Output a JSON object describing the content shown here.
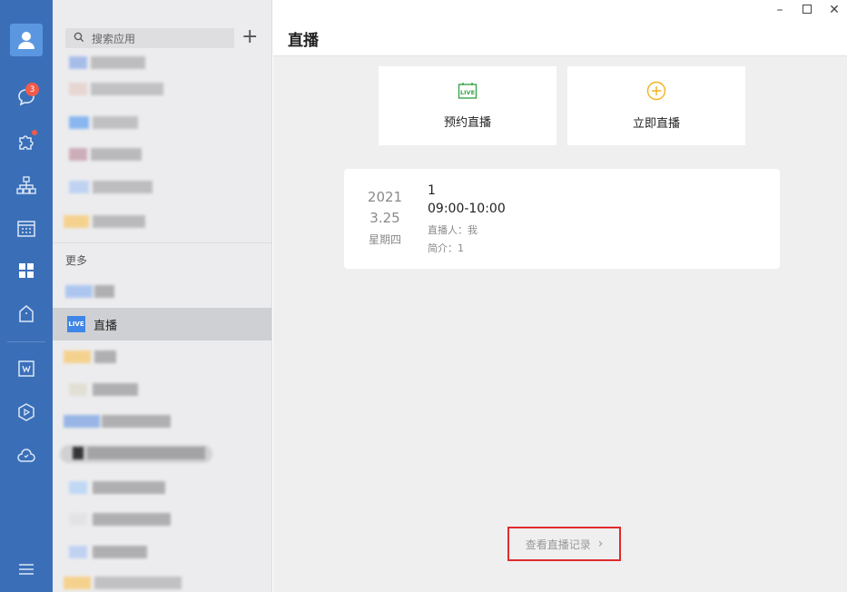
{
  "rail": {
    "badge_count": "3",
    "icons": [
      "user-avatar-icon",
      "chat-icon",
      "puzzle-icon",
      "org-chart-icon",
      "calendar-icon",
      "apps-grid-icon",
      "house-icon",
      "document-icon",
      "cube-icon",
      "phone-cloud-icon",
      "menu-icon"
    ]
  },
  "list": {
    "search_placeholder": "搜索应用",
    "section_more": "更多",
    "live_tag": "LIVE",
    "live_label": "直播"
  },
  "main": {
    "title": "直播",
    "reserve_label": "预约直播",
    "start_label": "立即直播",
    "live_card": {
      "year": "2021",
      "date": "3.25",
      "weekday": "星期四",
      "name": "1",
      "time": "09:00-10:00",
      "host": "直播人：我",
      "intro": "简介：1"
    },
    "history_label": "查看直播记录"
  },
  "colors": {
    "rail": "#3a6fb8",
    "accent_green": "#3aa64a",
    "accent_yellow": "#f2b21f",
    "highlight_border": "#e02b2b"
  }
}
